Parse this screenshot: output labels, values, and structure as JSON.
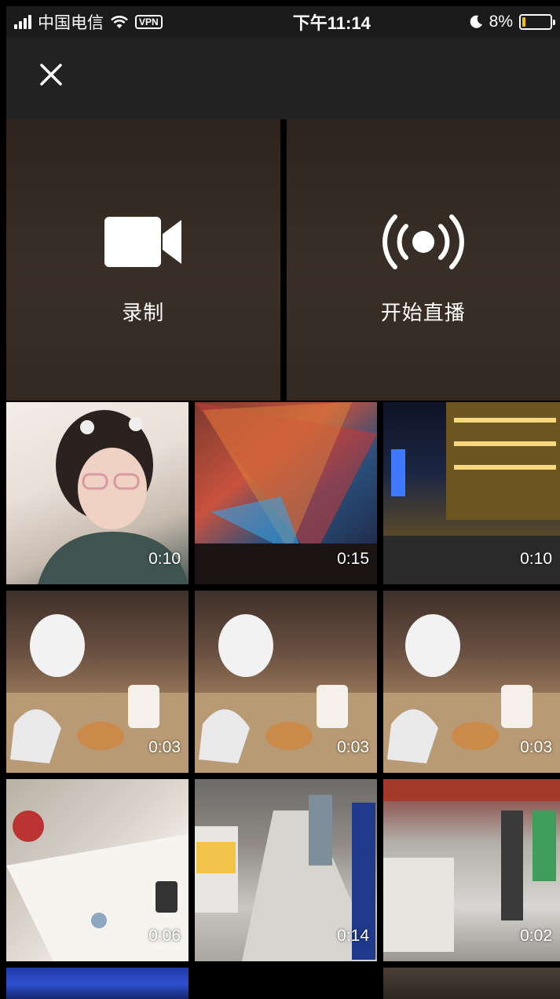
{
  "status_bar": {
    "carrier": "中国电信",
    "vpn": "VPN",
    "time": "下午11:14",
    "battery": "8%",
    "battery_color": "#f5c000"
  },
  "header": {
    "close_icon": "close-icon"
  },
  "actions": [
    {
      "label": "录制",
      "icon": "video-camera-icon"
    },
    {
      "label": "开始直播",
      "icon": "live-broadcast-icon"
    }
  ],
  "videos": [
    {
      "duration": "0:10"
    },
    {
      "duration": "0:15"
    },
    {
      "duration": "0:10"
    },
    {
      "duration": "0:03"
    },
    {
      "duration": "0:03"
    },
    {
      "duration": "0:03"
    },
    {
      "duration": "0:06"
    },
    {
      "duration": "0:14"
    },
    {
      "duration": "0:02"
    }
  ]
}
